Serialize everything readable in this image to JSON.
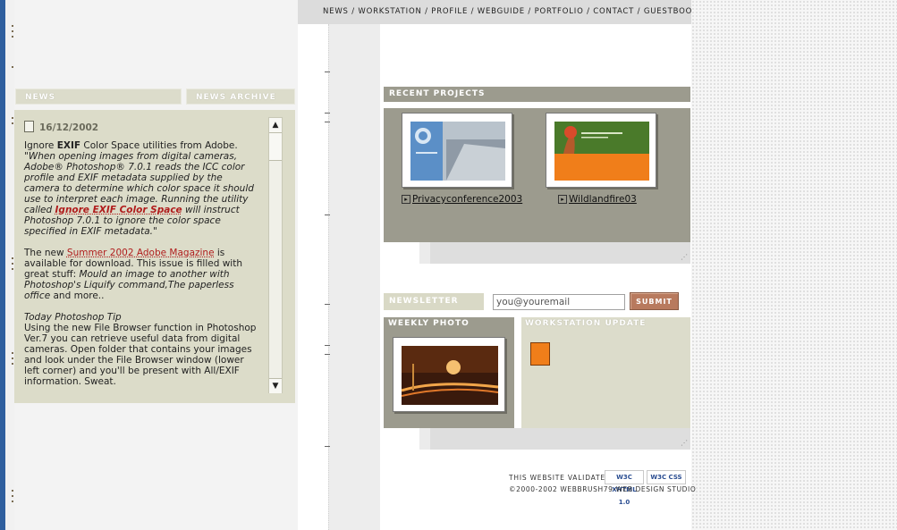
{
  "nav": {
    "items": [
      "NEWS",
      "WORKSTATION",
      "PROFILE",
      "WEBGUIDE",
      "PORTFOLIO",
      "CONTACT",
      "GUESTBOOK"
    ],
    "separator": " / "
  },
  "left": {
    "tab_news": "NEWS",
    "tab_archive": "NEWS ARCHIVE",
    "news": {
      "date": "16/12/2002",
      "p1_a": "Ignore ",
      "p1_exif": "EXIF",
      "p1_b": " Color Space utilities from Adobe.",
      "p1_quote": "\"When opening images from digital cameras, Adobe® Photoshop® 7.0.1 reads the ICC color profile and EXIF metadata supplied by the camera to determine which color space it should use to interpret each image. Running the utility called ",
      "p1_link": "Ignore EXIF Color Space",
      "p1_quote_end": " will instruct Photoshop 7.0.1 to ignore the color space specified in EXIF metadata.\"",
      "p2_a": "The new ",
      "p2_link": "Summer 2002 Adobe Magazine",
      "p2_b": " is available for download. This issue is filled with great stuff: ",
      "p2_em": "Mould an image to another with Photoshop's Liquify command,The paperless office",
      "p2_c": " and more..",
      "p3_title": "Today Photoshop Tip",
      "p3_body": "Using the new File Browser function in Photoshop Ver.7 you can retrieve useful data from digital cameras. Open folder that contains your images and look under the File Browser window (lower left corner) and you'll be present with All/EXIF information. Sweat."
    },
    "scroll_up": "▲",
    "scroll_down": "▼"
  },
  "recent_projects": {
    "title": "RECENT PROJECTS",
    "items": [
      {
        "label": "Privacyconference2003"
      },
      {
        "label": "Wildlandfire03"
      }
    ]
  },
  "newsletter": {
    "label": "NEWSLETTER",
    "input_value": "you@youremail",
    "submit": "SUBMIT"
  },
  "weekly_photo": {
    "title": "WEEKLY PHOTO"
  },
  "workstation_update": {
    "title": "WORKSTATION UPDATE"
  },
  "footer": {
    "validates": "THIS WEBSITE VALIDATES",
    "copyright": "©2000-2002 WEBBRUSH79-WEB DESIGN STUDIO",
    "badge_xhtml": "W3C XHTML 1.0",
    "badge_css": "W3C CSS"
  },
  "colors": {
    "panel_khaki": "#dcdccb",
    "header_gray": "#9c9b8e",
    "submit": "#b87a5e",
    "link_red": "#b01c1c"
  }
}
